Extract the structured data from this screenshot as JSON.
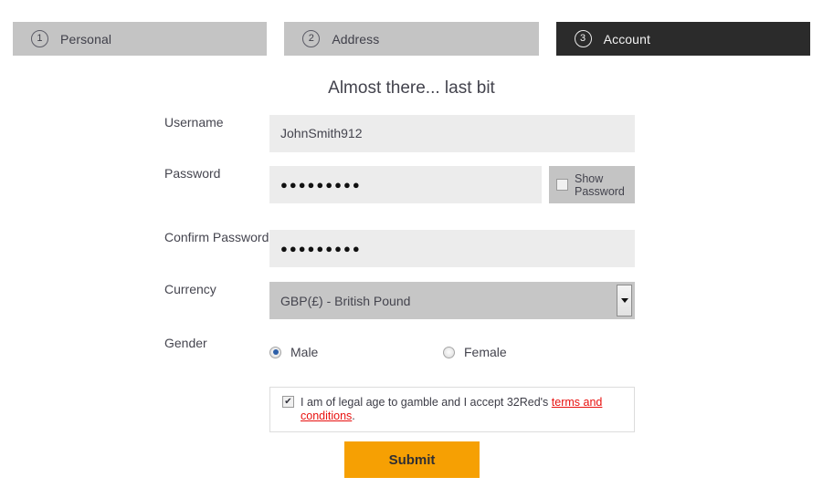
{
  "wizard": {
    "tabs": [
      {
        "number": "1",
        "label": "Personal",
        "active": false
      },
      {
        "number": "2",
        "label": "Address",
        "active": false
      },
      {
        "number": "3",
        "label": "Account",
        "active": true
      }
    ]
  },
  "heading": "Almost there... last bit",
  "form": {
    "username": {
      "label": "Username",
      "value": "JohnSmith912",
      "placeholder": ""
    },
    "password": {
      "label": "Password",
      "value": "●●●●●●●●●",
      "placeholder": "",
      "show_password_label": "Show\nPassword",
      "show_password_checked": false
    },
    "confirm_password": {
      "label": "Confirm Password",
      "value": "●●●●●●●●●",
      "placeholder": ""
    },
    "currency": {
      "label": "Currency",
      "value": "GBP(£) - British Pound"
    },
    "gender": {
      "label": "Gender",
      "options": [
        {
          "label": "Male",
          "selected": true
        },
        {
          "label": "Female",
          "selected": false
        }
      ]
    },
    "terms": {
      "checked": true,
      "text_before": "I am of legal age to gamble and I accept 32Red's ",
      "link_text": "terms and conditions",
      "text_after": "."
    },
    "submit_label": "Submit"
  },
  "colors": {
    "accent_orange": "#f6a003",
    "tab_inactive": "#c4c4c4",
    "tab_active": "#2b2b2b",
    "input_bg": "#ececec",
    "select_bg": "#c6c6c6",
    "link_red": "#e8110f"
  }
}
